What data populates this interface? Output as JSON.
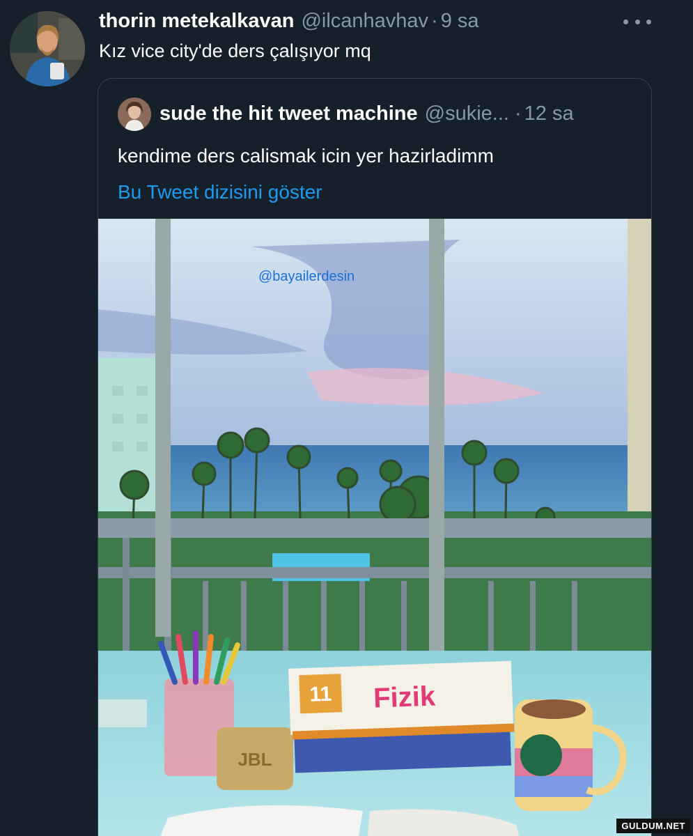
{
  "tweet": {
    "display_name": "thorin metekalkavan",
    "handle": "@ilcanhavhav",
    "dot": "·",
    "time": "9 sa",
    "text": "Kız vice city'de ders çalışıyor mq",
    "more_icon": "more-dots-icon"
  },
  "quoted": {
    "display_name": "sude the hit tweet machine",
    "handle": "@sukie...",
    "dot": "·",
    "time": "12 sa",
    "text": "kendime ders calismak icin yer hazirladimm",
    "thread_link": "Bu Tweet dizisini göster"
  },
  "photo": {
    "watermark": "@bayailerdesin",
    "book_title": "Fizik",
    "book_grade": "11",
    "speaker_brand": "JBL"
  },
  "site_badge": "GULDUM.NET",
  "colors": {
    "background": "#15202b",
    "secondary_text": "#8899a6",
    "link": "#1d9bf0",
    "border": "#38444d"
  }
}
